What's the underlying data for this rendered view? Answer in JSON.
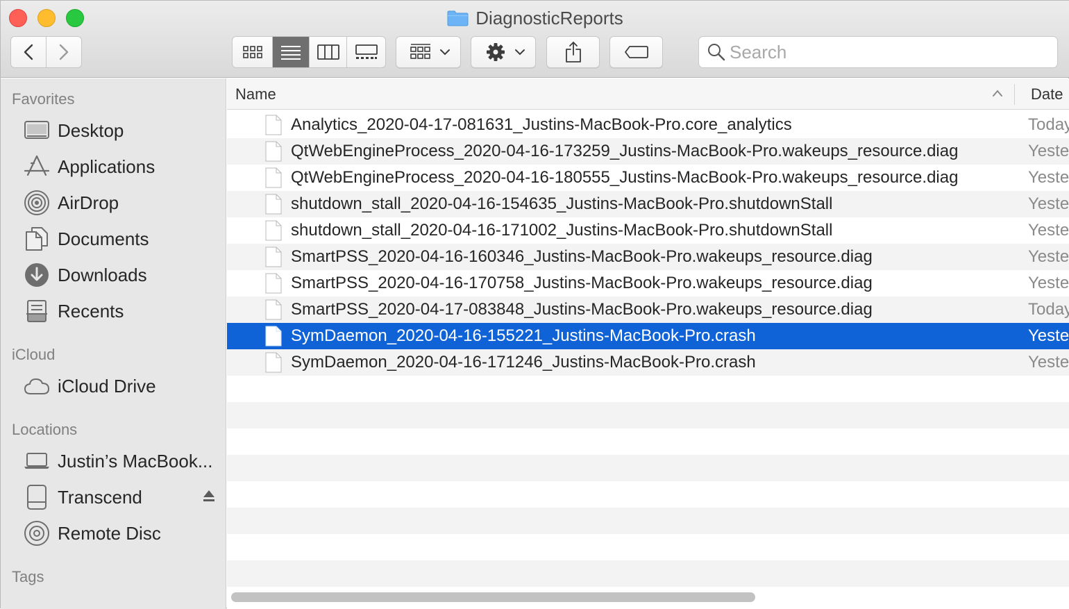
{
  "window": {
    "title": "DiagnosticReports"
  },
  "toolbar": {
    "search_placeholder": "Search",
    "view_modes": [
      "icon-view",
      "list-view",
      "column-view",
      "gallery-view"
    ],
    "active_view": "list-view"
  },
  "sidebar": {
    "sections": {
      "favorites": "Favorites",
      "icloud": "iCloud",
      "locations": "Locations",
      "tags": "Tags"
    },
    "favorites": [
      {
        "label": "Desktop",
        "icon": "desktop-icon"
      },
      {
        "label": "Applications",
        "icon": "applications-icon"
      },
      {
        "label": "AirDrop",
        "icon": "airdrop-icon"
      },
      {
        "label": "Documents",
        "icon": "documents-icon"
      },
      {
        "label": "Downloads",
        "icon": "downloads-icon"
      },
      {
        "label": "Recents",
        "icon": "recents-icon"
      }
    ],
    "icloud": [
      {
        "label": "iCloud Drive",
        "icon": "cloud-icon"
      }
    ],
    "locations": [
      {
        "label": "Justin’s MacBook...",
        "icon": "laptop-icon"
      },
      {
        "label": "Transcend",
        "icon": "external-drive-icon"
      },
      {
        "label": "Remote Disc",
        "icon": "disc-icon"
      }
    ]
  },
  "list": {
    "columns": {
      "name": "Name",
      "date": "Date"
    },
    "files": [
      {
        "name": "Analytics_2020-04-17-081631_Justins-MacBook-Pro.core_analytics",
        "date": "Today"
      },
      {
        "name": "QtWebEngineProcess_2020-04-16-173259_Justins-MacBook-Pro.wakeups_resource.diag",
        "date": "Yesterday"
      },
      {
        "name": "QtWebEngineProcess_2020-04-16-180555_Justins-MacBook-Pro.wakeups_resource.diag",
        "date": "Yesterday"
      },
      {
        "name": "shutdown_stall_2020-04-16-154635_Justins-MacBook-Pro.shutdownStall",
        "date": "Yesterday"
      },
      {
        "name": "shutdown_stall_2020-04-16-171002_Justins-MacBook-Pro.shutdownStall",
        "date": "Yesterday"
      },
      {
        "name": "SmartPSS_2020-04-16-160346_Justins-MacBook-Pro.wakeups_resource.diag",
        "date": "Yesterday"
      },
      {
        "name": "SmartPSS_2020-04-16-170758_Justins-MacBook-Pro.wakeups_resource.diag",
        "date": "Yesterday"
      },
      {
        "name": "SmartPSS_2020-04-17-083848_Justins-MacBook-Pro.wakeups_resource.diag",
        "date": "Today"
      },
      {
        "name": "SymDaemon_2020-04-16-155221_Justins-MacBook-Pro.crash",
        "date": "Yesterday",
        "selected": true
      },
      {
        "name": "SymDaemon_2020-04-16-171246_Justins-MacBook-Pro.crash",
        "date": "Yesterday"
      }
    ]
  },
  "colors": {
    "selection": "#0f63d6",
    "sidebar_bg": "#e7e7e7",
    "stripe": "#f3f3f3"
  }
}
